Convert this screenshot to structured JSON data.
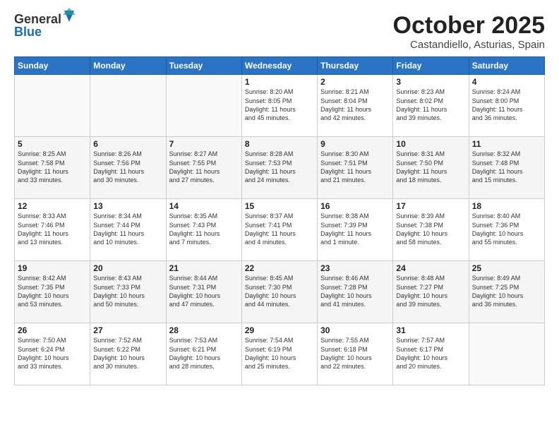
{
  "logo": {
    "general": "General",
    "blue": "Blue"
  },
  "header": {
    "month": "October 2025",
    "location": "Castandiello, Asturias, Spain"
  },
  "weekdays": [
    "Sunday",
    "Monday",
    "Tuesday",
    "Wednesday",
    "Thursday",
    "Friday",
    "Saturday"
  ],
  "weeks": [
    [
      {
        "day": "",
        "info": ""
      },
      {
        "day": "",
        "info": ""
      },
      {
        "day": "",
        "info": ""
      },
      {
        "day": "1",
        "info": "Sunrise: 8:20 AM\nSunset: 8:05 PM\nDaylight: 11 hours\nand 45 minutes."
      },
      {
        "day": "2",
        "info": "Sunrise: 8:21 AM\nSunset: 8:04 PM\nDaylight: 11 hours\nand 42 minutes."
      },
      {
        "day": "3",
        "info": "Sunrise: 8:23 AM\nSunset: 8:02 PM\nDaylight: 11 hours\nand 39 minutes."
      },
      {
        "day": "4",
        "info": "Sunrise: 8:24 AM\nSunset: 8:00 PM\nDaylight: 11 hours\nand 36 minutes."
      }
    ],
    [
      {
        "day": "5",
        "info": "Sunrise: 8:25 AM\nSunset: 7:58 PM\nDaylight: 11 hours\nand 33 minutes."
      },
      {
        "day": "6",
        "info": "Sunrise: 8:26 AM\nSunset: 7:56 PM\nDaylight: 11 hours\nand 30 minutes."
      },
      {
        "day": "7",
        "info": "Sunrise: 8:27 AM\nSunset: 7:55 PM\nDaylight: 11 hours\nand 27 minutes."
      },
      {
        "day": "8",
        "info": "Sunrise: 8:28 AM\nSunset: 7:53 PM\nDaylight: 11 hours\nand 24 minutes."
      },
      {
        "day": "9",
        "info": "Sunrise: 8:30 AM\nSunset: 7:51 PM\nDaylight: 11 hours\nand 21 minutes."
      },
      {
        "day": "10",
        "info": "Sunrise: 8:31 AM\nSunset: 7:50 PM\nDaylight: 11 hours\nand 18 minutes."
      },
      {
        "day": "11",
        "info": "Sunrise: 8:32 AM\nSunset: 7:48 PM\nDaylight: 11 hours\nand 15 minutes."
      }
    ],
    [
      {
        "day": "12",
        "info": "Sunrise: 8:33 AM\nSunset: 7:46 PM\nDaylight: 11 hours\nand 13 minutes."
      },
      {
        "day": "13",
        "info": "Sunrise: 8:34 AM\nSunset: 7:44 PM\nDaylight: 11 hours\nand 10 minutes."
      },
      {
        "day": "14",
        "info": "Sunrise: 8:35 AM\nSunset: 7:43 PM\nDaylight: 11 hours\nand 7 minutes."
      },
      {
        "day": "15",
        "info": "Sunrise: 8:37 AM\nSunset: 7:41 PM\nDaylight: 11 hours\nand 4 minutes."
      },
      {
        "day": "16",
        "info": "Sunrise: 8:38 AM\nSunset: 7:39 PM\nDaylight: 11 hours\nand 1 minute."
      },
      {
        "day": "17",
        "info": "Sunrise: 8:39 AM\nSunset: 7:38 PM\nDaylight: 10 hours\nand 58 minutes."
      },
      {
        "day": "18",
        "info": "Sunrise: 8:40 AM\nSunset: 7:36 PM\nDaylight: 10 hours\nand 55 minutes."
      }
    ],
    [
      {
        "day": "19",
        "info": "Sunrise: 8:42 AM\nSunset: 7:35 PM\nDaylight: 10 hours\nand 53 minutes."
      },
      {
        "day": "20",
        "info": "Sunrise: 8:43 AM\nSunset: 7:33 PM\nDaylight: 10 hours\nand 50 minutes."
      },
      {
        "day": "21",
        "info": "Sunrise: 8:44 AM\nSunset: 7:31 PM\nDaylight: 10 hours\nand 47 minutes."
      },
      {
        "day": "22",
        "info": "Sunrise: 8:45 AM\nSunset: 7:30 PM\nDaylight: 10 hours\nand 44 minutes."
      },
      {
        "day": "23",
        "info": "Sunrise: 8:46 AM\nSunset: 7:28 PM\nDaylight: 10 hours\nand 41 minutes."
      },
      {
        "day": "24",
        "info": "Sunrise: 8:48 AM\nSunset: 7:27 PM\nDaylight: 10 hours\nand 39 minutes."
      },
      {
        "day": "25",
        "info": "Sunrise: 8:49 AM\nSunset: 7:25 PM\nDaylight: 10 hours\nand 36 minutes."
      }
    ],
    [
      {
        "day": "26",
        "info": "Sunrise: 7:50 AM\nSunset: 6:24 PM\nDaylight: 10 hours\nand 33 minutes."
      },
      {
        "day": "27",
        "info": "Sunrise: 7:52 AM\nSunset: 6:22 PM\nDaylight: 10 hours\nand 30 minutes."
      },
      {
        "day": "28",
        "info": "Sunrise: 7:53 AM\nSunset: 6:21 PM\nDaylight: 10 hours\nand 28 minutes."
      },
      {
        "day": "29",
        "info": "Sunrise: 7:54 AM\nSunset: 6:19 PM\nDaylight: 10 hours\nand 25 minutes."
      },
      {
        "day": "30",
        "info": "Sunrise: 7:55 AM\nSunset: 6:18 PM\nDaylight: 10 hours\nand 22 minutes."
      },
      {
        "day": "31",
        "info": "Sunrise: 7:57 AM\nSunset: 6:17 PM\nDaylight: 10 hours\nand 20 minutes."
      },
      {
        "day": "",
        "info": ""
      }
    ]
  ]
}
